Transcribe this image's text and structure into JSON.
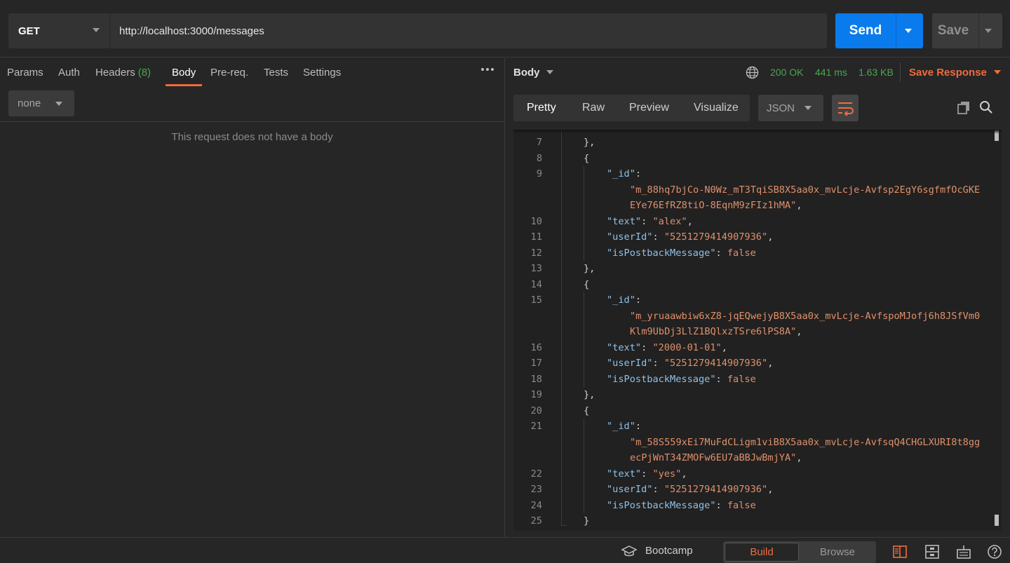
{
  "request": {
    "method": "GET",
    "url": "http://localhost:3000/messages",
    "send_label": "Send",
    "save_label": "Save"
  },
  "request_tabs": [
    {
      "label": "Params"
    },
    {
      "label": "Auth"
    },
    {
      "label": "Headers",
      "count": "(8)"
    },
    {
      "label": "Body",
      "active": true
    },
    {
      "label": "Pre-req."
    },
    {
      "label": "Tests"
    },
    {
      "label": "Settings"
    }
  ],
  "body_type": "none",
  "no_body_message": "This request does not have a body",
  "response": {
    "section_label": "Body",
    "status": "200 OK",
    "time": "441 ms",
    "size": "1.63 KB",
    "save_response_label": "Save Response",
    "view_tabs": [
      "Pretty",
      "Raw",
      "Preview",
      "Visualize"
    ],
    "active_view": "Pretty",
    "format": "JSON"
  },
  "code_lines": [
    {
      "n": "7",
      "text": "},"
    },
    {
      "n": "8",
      "text": "{"
    },
    {
      "n": "9",
      "key": "\"_id\"",
      "after": ":"
    },
    {
      "n": "",
      "str": "\"m_88hq7bjCo-N0Wz_mT3TqiSB8X5aa0x_mvLcje-Avfsp2EgY6sgfmfOcGKE"
    },
    {
      "n": "",
      "str": "EYe76EfRZ8tiO-8EqnM9zFIz1hMA\"",
      "after": ","
    },
    {
      "n": "10",
      "key": "\"text\"",
      "after": ": ",
      "str": "\"alex\"",
      "tail": ","
    },
    {
      "n": "11",
      "key": "\"userId\"",
      "after": ": ",
      "str": "\"5251279414907936\"",
      "tail": ","
    },
    {
      "n": "12",
      "key": "\"isPostbackMessage\"",
      "after": ": ",
      "bool": "false"
    },
    {
      "n": "13",
      "text": "},"
    },
    {
      "n": "14",
      "text": "{"
    },
    {
      "n": "15",
      "key": "\"_id\"",
      "after": ":"
    },
    {
      "n": "",
      "str": "\"m_yruaawbiw6xZ8-jqEQwejyB8X5aa0x_mvLcje-AvfspoMJofj6h8JSfVm0"
    },
    {
      "n": "",
      "str": "Klm9UbDj3LlZ1BQlxzTSre6lPS8A\"",
      "after": ","
    },
    {
      "n": "16",
      "key": "\"text\"",
      "after": ": ",
      "str": "\"2000-01-01\"",
      "tail": ","
    },
    {
      "n": "17",
      "key": "\"userId\"",
      "after": ": ",
      "str": "\"5251279414907936\"",
      "tail": ","
    },
    {
      "n": "18",
      "key": "\"isPostbackMessage\"",
      "after": ": ",
      "bool": "false"
    },
    {
      "n": "19",
      "text": "},"
    },
    {
      "n": "20",
      "text": "{"
    },
    {
      "n": "21",
      "key": "\"_id\"",
      "after": ":"
    },
    {
      "n": "",
      "str": "\"m_58S559xEi7MuFdCLigm1viB8X5aa0x_mvLcje-AvfsqQ4CHGLXURI8t8gg"
    },
    {
      "n": "",
      "str": "ecPjWnT34ZMOFw6EU7aBBJwBmjYA\"",
      "after": ","
    },
    {
      "n": "22",
      "key": "\"text\"",
      "after": ": ",
      "str": "\"yes\"",
      "tail": ","
    },
    {
      "n": "23",
      "key": "\"userId\"",
      "after": ": ",
      "str": "\"5251279414907936\"",
      "tail": ","
    },
    {
      "n": "24",
      "key": "\"isPostbackMessage\"",
      "after": ": ",
      "bool": "false"
    },
    {
      "n": "25",
      "text": "}"
    }
  ],
  "statusbar": {
    "bootcamp_label": "Bootcamp",
    "build_label": "Build",
    "browse_label": "Browse"
  },
  "colors": {
    "accent": "#ef6c3f",
    "send": "#097bed",
    "success": "#49a84f",
    "json_key": "#8fc1e8",
    "json_string": "#e0906b"
  }
}
